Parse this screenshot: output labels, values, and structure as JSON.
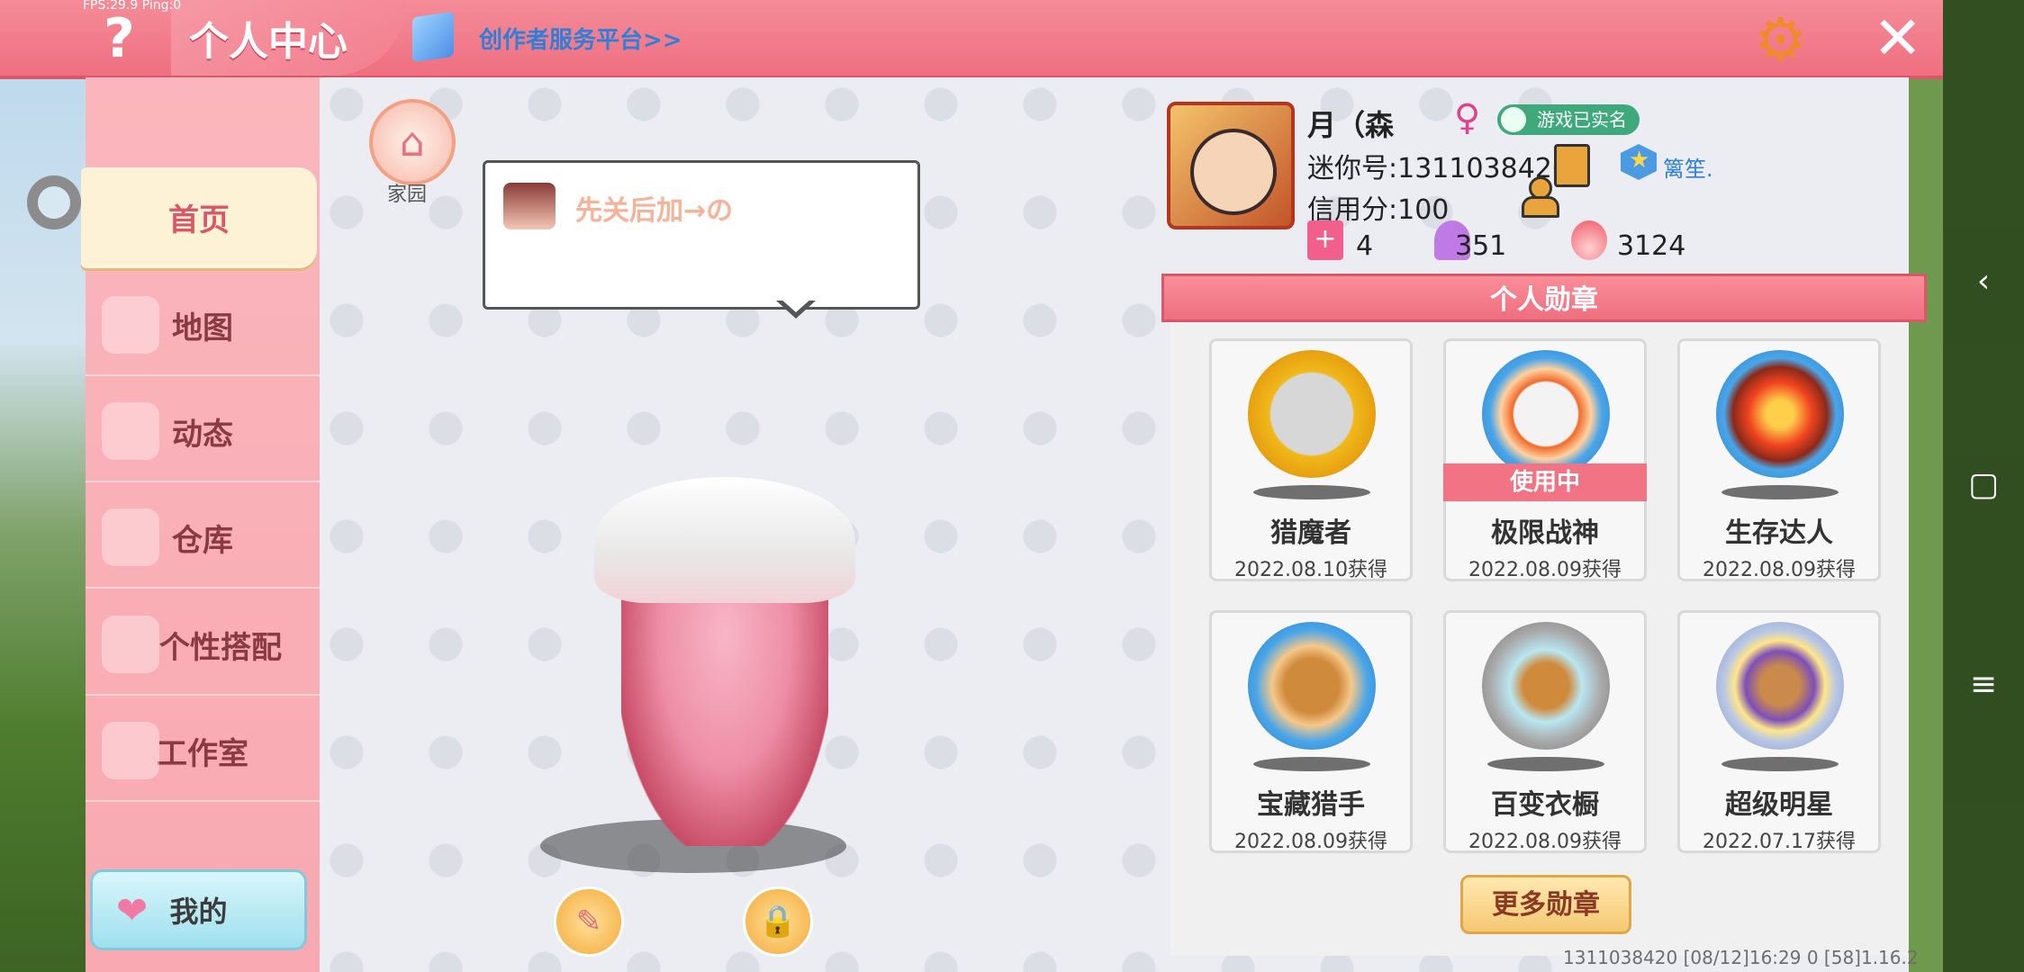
{
  "topbar": {
    "fps": "FPS:29.9  Ping:0",
    "help_icon": "?",
    "title": "个人中心",
    "creator_link": "创作者服务平台>>",
    "settings_icon": "gear-icon",
    "close_icon": "close-icon"
  },
  "sidebar": {
    "items": [
      {
        "label": "首页",
        "active": true
      },
      {
        "label": "地图"
      },
      {
        "label": "动态"
      },
      {
        "label": "仓库"
      },
      {
        "label": "个性搭配"
      },
      {
        "label": "工作室"
      }
    ],
    "mine_button": "我的"
  },
  "home": {
    "label": "家园"
  },
  "bubble": {
    "text": "先关后加→の"
  },
  "profile": {
    "nickname": "月（森",
    "realname_badge": "游戏已实名",
    "mini_id": "迷你号:1311038420",
    "friend_name": "篱笙.",
    "credit": "信用分:100",
    "stats": {
      "likes": "4",
      "fans": "351",
      "popularity": "3124"
    }
  },
  "badges": {
    "header": "个人勋章",
    "in_use_label": "使用中",
    "items": [
      {
        "name": "猎魔者",
        "date": "2022.08.10获得"
      },
      {
        "name": "极限战神",
        "date": "2022.08.09获得",
        "in_use": true
      },
      {
        "name": "生存达人",
        "date": "2022.08.09获得"
      },
      {
        "name": "宝藏猎手",
        "date": "2022.08.09获得"
      },
      {
        "name": "百变衣橱",
        "date": "2022.08.09获得"
      },
      {
        "name": "超级明星",
        "date": "2022.07.17获得"
      }
    ],
    "more_button": "更多勋章"
  },
  "footer": {
    "info": "1311038420   [08/12]16:29 0   [58]1.16.2"
  },
  "colors": {
    "accent": "#ef6f80",
    "panel": "#ecedf3",
    "badge_in_use": "#f27383"
  }
}
